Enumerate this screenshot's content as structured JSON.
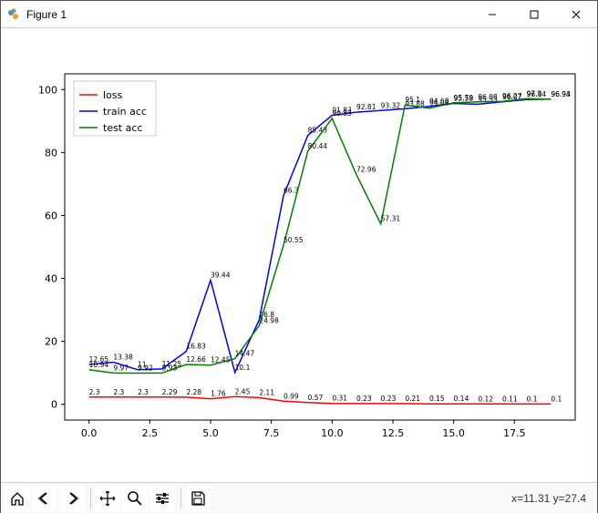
{
  "window": {
    "title": "Figure 1"
  },
  "toolbar_icons": {
    "home": "home-icon",
    "back": "back-icon",
    "forward": "forward-icon",
    "pan": "pan-icon",
    "zoom": "zoom-icon",
    "configure": "configure-icon",
    "save": "save-icon"
  },
  "coord_readout": "x=11.31 y=27.4",
  "chart_data": {
    "type": "line",
    "title": "",
    "xlabel": "",
    "ylabel": "",
    "xlim": [
      -1,
      20
    ],
    "ylim": [
      -5,
      105
    ],
    "xticks": [
      0.0,
      2.5,
      5.0,
      7.5,
      10.0,
      12.5,
      15.0,
      17.5
    ],
    "yticks": [
      0,
      20,
      40,
      60,
      80,
      100
    ],
    "xtick_labels": [
      "0.0",
      "2.5",
      "5.0",
      "7.5",
      "10.0",
      "12.5",
      "15.0",
      "17.5"
    ],
    "ytick_labels": [
      "0",
      "20",
      "40",
      "60",
      "80",
      "100"
    ],
    "x": [
      0,
      1,
      2,
      3,
      4,
      5,
      6,
      7,
      8,
      9,
      10,
      11,
      12,
      13,
      14,
      15,
      16,
      17,
      18,
      19
    ],
    "series": [
      {
        "name": "loss",
        "color": "#ff0000",
        "values": [
          2.3,
          2.3,
          2.3,
          2.29,
          2.28,
          1.76,
          2.45,
          2.11,
          0.99,
          0.57,
          0.31,
          0.23,
          0.23,
          0.21,
          0.15,
          0.14,
          0.12,
          0.11,
          0.1,
          0.1
        ]
      },
      {
        "name": "train acc",
        "color": "#0000ff",
        "values": [
          12.65,
          13.38,
          11.0,
          11.25,
          16.83,
          39.44,
          10.1,
          26.8,
          66.3,
          85.43,
          91.83,
          92.81,
          93.32,
          93.88,
          94.68,
          95.58,
          95.33,
          96.07,
          96.84,
          96.94
        ]
      },
      {
        "name": "test acc",
        "color": "#008000",
        "values": [
          10.94,
          9.97,
          9.92,
          9.93,
          12.66,
          12.45,
          14.47,
          24.98,
          50.55,
          80.44,
          90.83,
          72.96,
          57.31,
          95.1,
          94.08,
          95.79,
          96.08,
          96.27,
          97.1,
          96.93
        ]
      }
    ],
    "legend": {
      "position": "upper left",
      "entries": [
        "loss",
        "train acc",
        "test acc"
      ]
    }
  }
}
